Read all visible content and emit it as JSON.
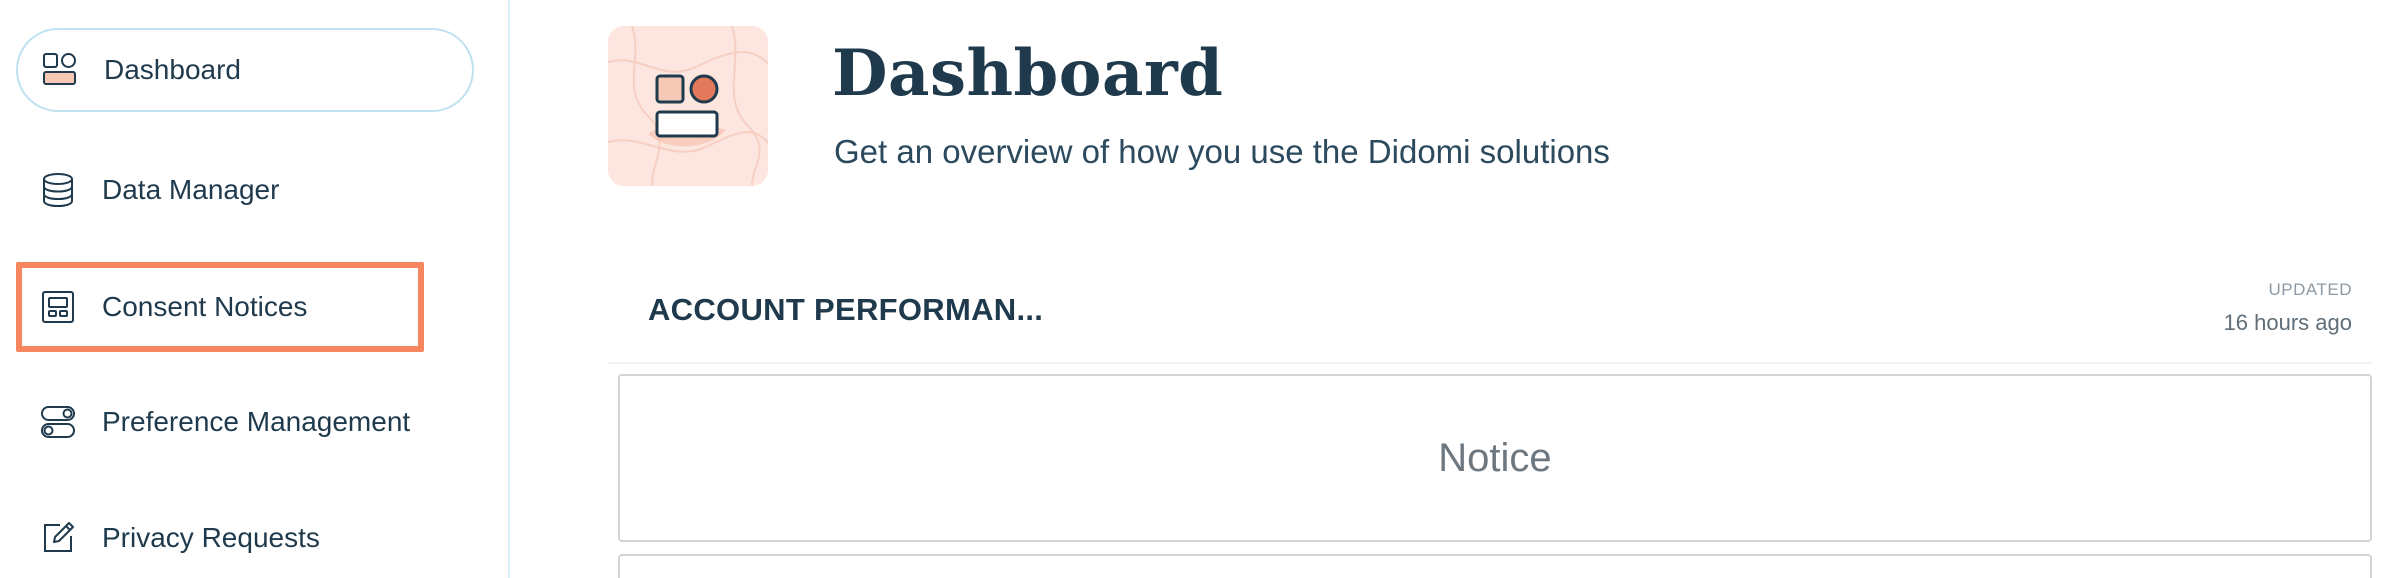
{
  "sidebar": {
    "items": [
      {
        "label": "Dashboard",
        "icon": "dashboard-icon",
        "state": "active"
      },
      {
        "label": "Data Manager",
        "icon": "database-icon",
        "state": "default"
      },
      {
        "label": "Consent Notices",
        "icon": "consent-notice-icon",
        "state": "highlighted"
      },
      {
        "label": "Preference Management",
        "icon": "toggles-icon",
        "state": "default"
      },
      {
        "label": "Privacy Requests",
        "icon": "edit-request-icon",
        "state": "default"
      }
    ]
  },
  "header": {
    "title": "Dashboard",
    "subtitle": "Get an overview of how you use the Didomi solutions",
    "icon": "dashboard-illustration-icon"
  },
  "section": {
    "title": "ACCOUNT PERFORMAN...",
    "updated_label": "UPDATED",
    "updated_time": "16 hours ago"
  },
  "cards": {
    "notice_label": "Notice"
  },
  "colors": {
    "text_primary": "#1f3a4d",
    "highlight_border": "#f5865f",
    "active_border": "#bfe2ef",
    "hero_background": "#fde6df",
    "accent_orange": "#e2795d"
  }
}
